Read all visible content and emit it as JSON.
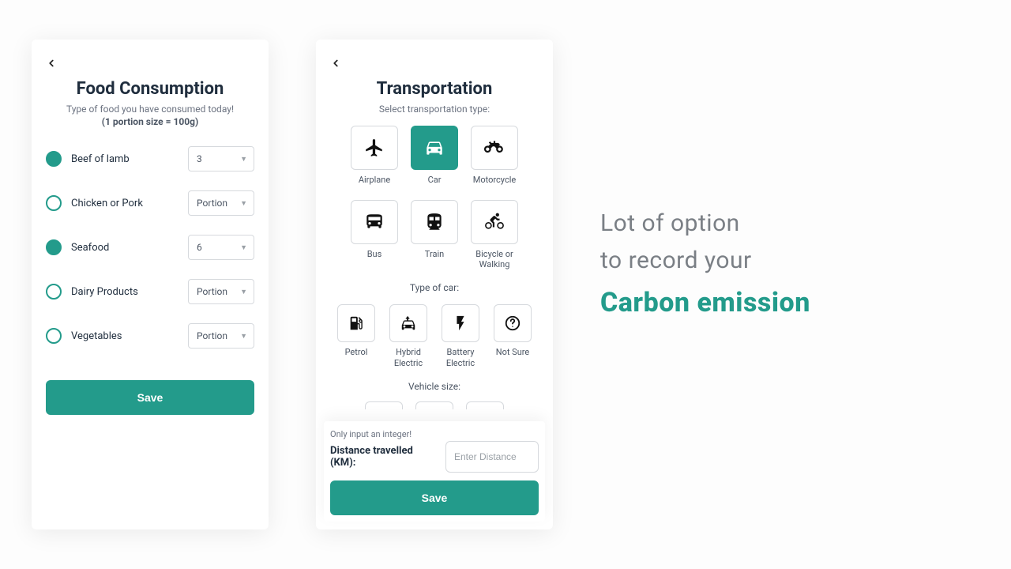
{
  "food_screen": {
    "title": "Food Consumption",
    "subtitle": "Type of food you have consumed today!",
    "portion_note": "(1 portion size = 100g)",
    "items": [
      {
        "label": "Beef of lamb",
        "selected": true,
        "value": "3"
      },
      {
        "label": "Chicken or Pork",
        "selected": false,
        "value": "Portion"
      },
      {
        "label": "Seafood",
        "selected": true,
        "value": "6"
      },
      {
        "label": "Dairy Products",
        "selected": false,
        "value": "Portion"
      },
      {
        "label": "Vegetables",
        "selected": false,
        "value": "Portion"
      }
    ],
    "save_label": "Save"
  },
  "transport_screen": {
    "title": "Transportation",
    "subtitle": "Select transportation type:",
    "types": [
      {
        "label": "Airplane",
        "selected": false,
        "icon": "airplane"
      },
      {
        "label": "Car",
        "selected": true,
        "icon": "car"
      },
      {
        "label": "Motorcycle",
        "selected": false,
        "icon": "motorcycle"
      },
      {
        "label": "Bus",
        "selected": false,
        "icon": "bus"
      },
      {
        "label": "Train",
        "selected": false,
        "icon": "train"
      },
      {
        "label": "Bicycle or Walking",
        "selected": false,
        "icon": "bicycle"
      }
    ],
    "car_type_label": "Type of car:",
    "car_types": [
      {
        "label": "Petrol",
        "icon": "petrol"
      },
      {
        "label": "Hybrid Electric",
        "icon": "hybrid"
      },
      {
        "label": "Battery Electric",
        "icon": "bolt"
      },
      {
        "label": "Not Sure",
        "icon": "question"
      }
    ],
    "vehicle_size_label": "Vehicle size:",
    "distance_hint": "Only input an integer!",
    "distance_label": "Distance travelled (KM):",
    "distance_placeholder": "Enter Distance",
    "save_label": "Save"
  },
  "promo": {
    "line1": "Lot of option",
    "line2": "to record your",
    "accent": "Carbon emission"
  }
}
